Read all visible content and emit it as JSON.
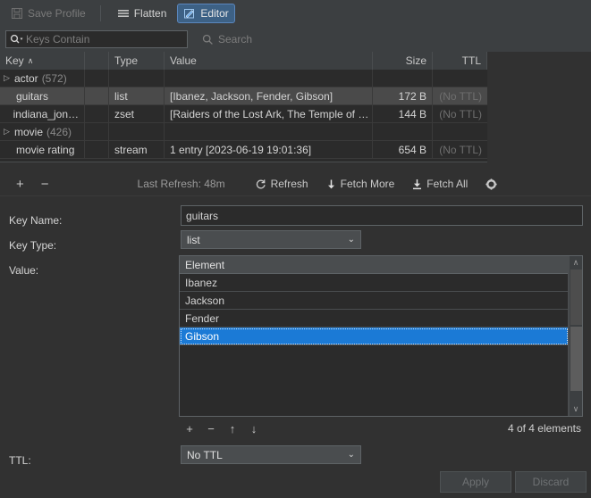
{
  "toolbar": {
    "save_profile": {
      "label": "Save Profile",
      "icon": "save-icon",
      "enabled": false
    },
    "flatten": {
      "label": "Flatten",
      "icon": "flatten-icon",
      "active": false
    },
    "editor": {
      "label": "Editor",
      "icon": "editor-pencil-icon",
      "active": true
    }
  },
  "search": {
    "placeholder": "Keys Contain",
    "value": "",
    "icon": "magnifier-dropdown-icon",
    "button_label": "Search",
    "button_icon": "search-icon"
  },
  "key_table": {
    "columns": [
      "Key",
      "Type",
      "Value",
      "Size",
      "TTL"
    ],
    "sort_column": "Key",
    "sort_direction": "ascending",
    "sort_caret": "∧",
    "rows": [
      {
        "key": "actor",
        "count": "(572)",
        "type": "",
        "value": "",
        "size": "",
        "ttl": "",
        "group": true,
        "expanded": false,
        "selected": false
      },
      {
        "key": "guitars",
        "count": "",
        "type": "list",
        "value": "[Ibanez, Jackson, Fender, Gibson]",
        "size": "172 B",
        "ttl": "(No TTL)",
        "group": false,
        "expanded": false,
        "selected": true
      },
      {
        "key": "indiana_jon…",
        "count": "",
        "type": "zset",
        "value": "[Raiders of the Lost Ark, The Temple of …",
        "size": "144 B",
        "ttl": "(No TTL)",
        "group": false,
        "expanded": false,
        "selected": false
      },
      {
        "key": "movie",
        "count": "(426)",
        "type": "",
        "value": "",
        "size": "",
        "ttl": "",
        "group": true,
        "expanded": false,
        "selected": false
      },
      {
        "key": "movie rating",
        "count": "",
        "type": "stream",
        "value": "1 entry [2023-06-19 19:01:36]",
        "size": "654 B",
        "ttl": "(No TTL)",
        "group": false,
        "expanded": false,
        "selected": false
      }
    ]
  },
  "mid_toolbar": {
    "add_label": "+",
    "remove_label": "−",
    "last_refresh": "Last Refresh: 48m",
    "refresh_label": "Refresh",
    "refresh_icon": "refresh-icon",
    "fetch_more_label": "Fetch More",
    "fetch_more_icon": "arrow-down-icon",
    "fetch_all_label": "Fetch All",
    "fetch_all_icon": "download-all-icon",
    "settings_icon": "gear-icon"
  },
  "editor": {
    "key_name_label": "Key Name:",
    "key_name_value": "guitars",
    "key_type_label": "Key Type:",
    "key_type_value": "list",
    "value_label": "Value:",
    "list_header": "Element",
    "elements": [
      {
        "text": "Ibanez",
        "selected": false
      },
      {
        "text": "Jackson",
        "selected": false
      },
      {
        "text": "Fender",
        "selected": false
      },
      {
        "text": "Gibson",
        "selected": true
      }
    ],
    "element_count": "4 of 4 elements",
    "list_buttons": {
      "add": "+",
      "remove": "−",
      "move_up": "↑",
      "move_down": "↓"
    },
    "scroll_up_icon": "∧",
    "scroll_down_icon": "∨",
    "ttl_label": "TTL:",
    "ttl_value": "No TTL",
    "apply_label": "Apply",
    "discard_label": "Discard",
    "apply_enabled": false,
    "discard_enabled": false
  },
  "colors": {
    "background": "#313131",
    "panel": "#3c3f41",
    "table_bg": "#2b2b2b",
    "row_selected": "#4a4a4a",
    "accent_blue": "#1b7ad6",
    "toolbar_active": "#3d6185",
    "text": "#d4d4d4",
    "muted": "#7d7d7d"
  }
}
